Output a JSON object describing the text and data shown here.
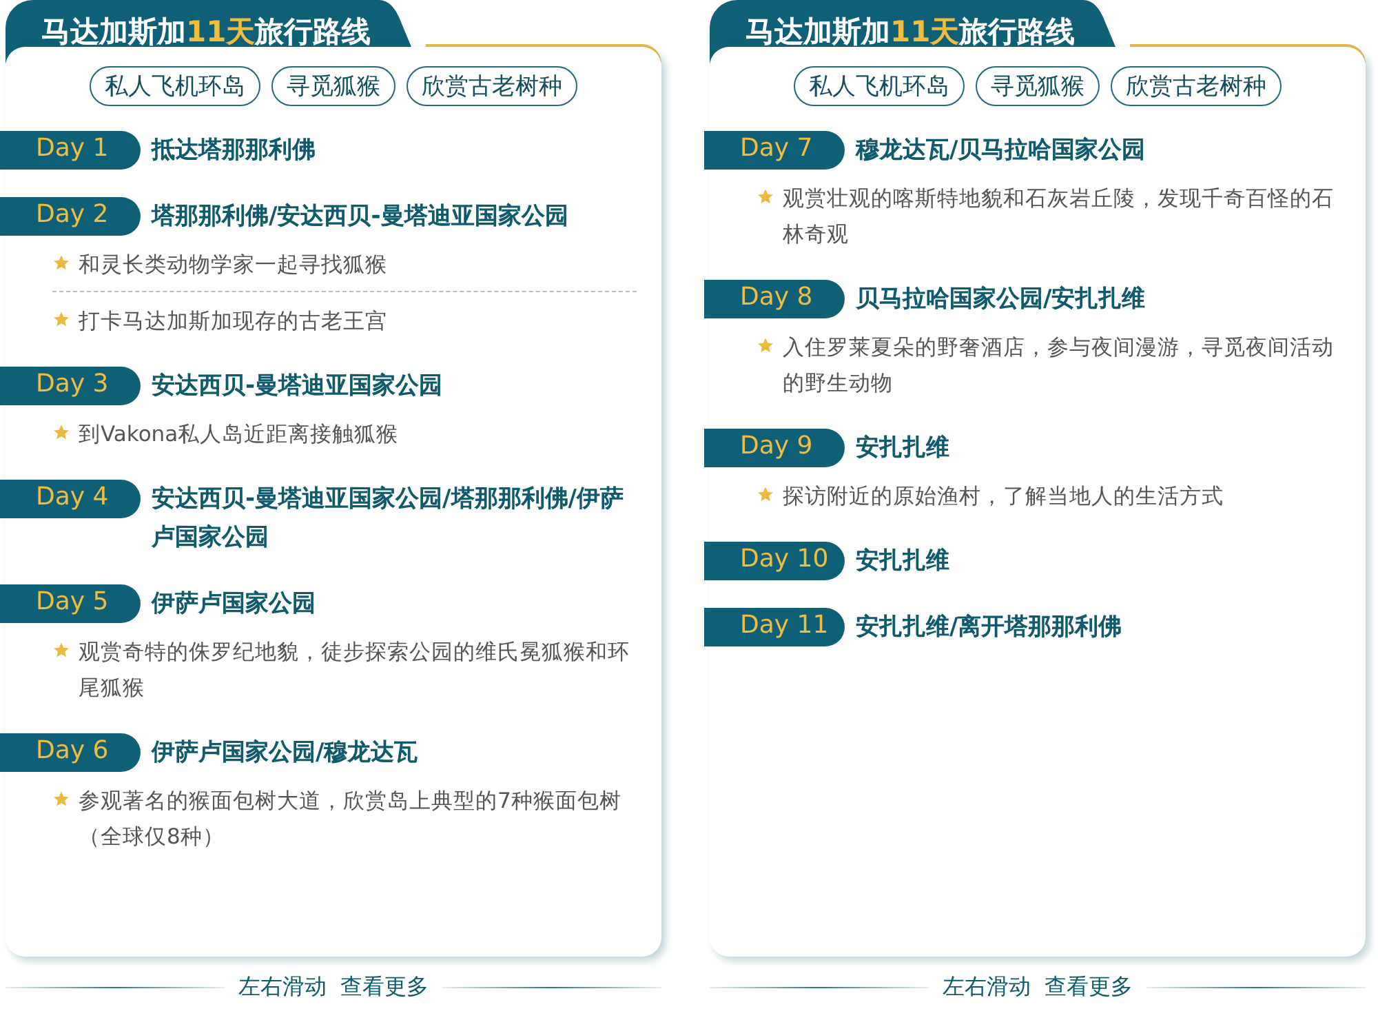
{
  "cards": [
    {
      "title": {
        "before": "马达加斯加",
        "highlight": "11天",
        "after": "旅行路线"
      },
      "tags": [
        "私人飞机环岛",
        "寻觅狐猴",
        "欣赏古老树种"
      ],
      "days": [
        {
          "label": "Day 1",
          "place": "抵达塔那那利佛"
        },
        {
          "label": "Day 2",
          "place": "塔那那利佛/安达西贝-曼塔迪亚国家公园",
          "notes": [
            "和灵长类动物学家一起寻找狐猴",
            "打卡马达加斯加现存的古老王宫"
          ]
        },
        {
          "label": "Day 3",
          "place": "安达西贝-曼塔迪亚国家公园",
          "notes": [
            "到Vakona私人岛近距离接触狐猴"
          ]
        },
        {
          "label": "Day 4",
          "place": "安达西贝-曼塔迪亚国家公园/塔那那利佛/伊萨卢国家公园"
        },
        {
          "label": "Day 5",
          "place": "伊萨卢国家公园",
          "notes": [
            "观赏奇特的侏罗纪地貌，徒步探索公园的维氏冕狐猴和环尾狐猴"
          ]
        },
        {
          "label": "Day 6",
          "place": "伊萨卢国家公园/穆龙达瓦",
          "notes": [
            "参观著名的猴面包树大道，欣赏岛上典型的7种猴面包树（全球仅8种）"
          ]
        }
      ],
      "footer": [
        "左右滑动",
        "查看更多"
      ]
    },
    {
      "title": {
        "before": "马达加斯加",
        "highlight": "11天",
        "after": "旅行路线"
      },
      "tags": [
        "私人飞机环岛",
        "寻觅狐猴",
        "欣赏古老树种"
      ],
      "days": [
        {
          "label": "Day 7",
          "place": "穆龙达瓦/贝马拉哈国家公园",
          "notes": [
            "观赏壮观的喀斯特地貌和石灰岩丘陵，发现千奇百怪的石林奇观"
          ]
        },
        {
          "label": "Day 8",
          "place": "贝马拉哈国家公园/安扎扎维",
          "notes": [
            "入住罗莱夏朵的野奢酒店，参与夜间漫游，寻觅夜间活动的野生动物"
          ]
        },
        {
          "label": "Day 9",
          "place": "安扎扎维",
          "notes": [
            "探访附近的原始渔村，了解当地人的生活方式"
          ]
        },
        {
          "label": "Day 10",
          "place": "安扎扎维"
        },
        {
          "label": "Day 11",
          "place": "安扎扎维/离开塔那那利佛"
        }
      ],
      "footer": [
        "左右滑动",
        "查看更多"
      ]
    }
  ]
}
